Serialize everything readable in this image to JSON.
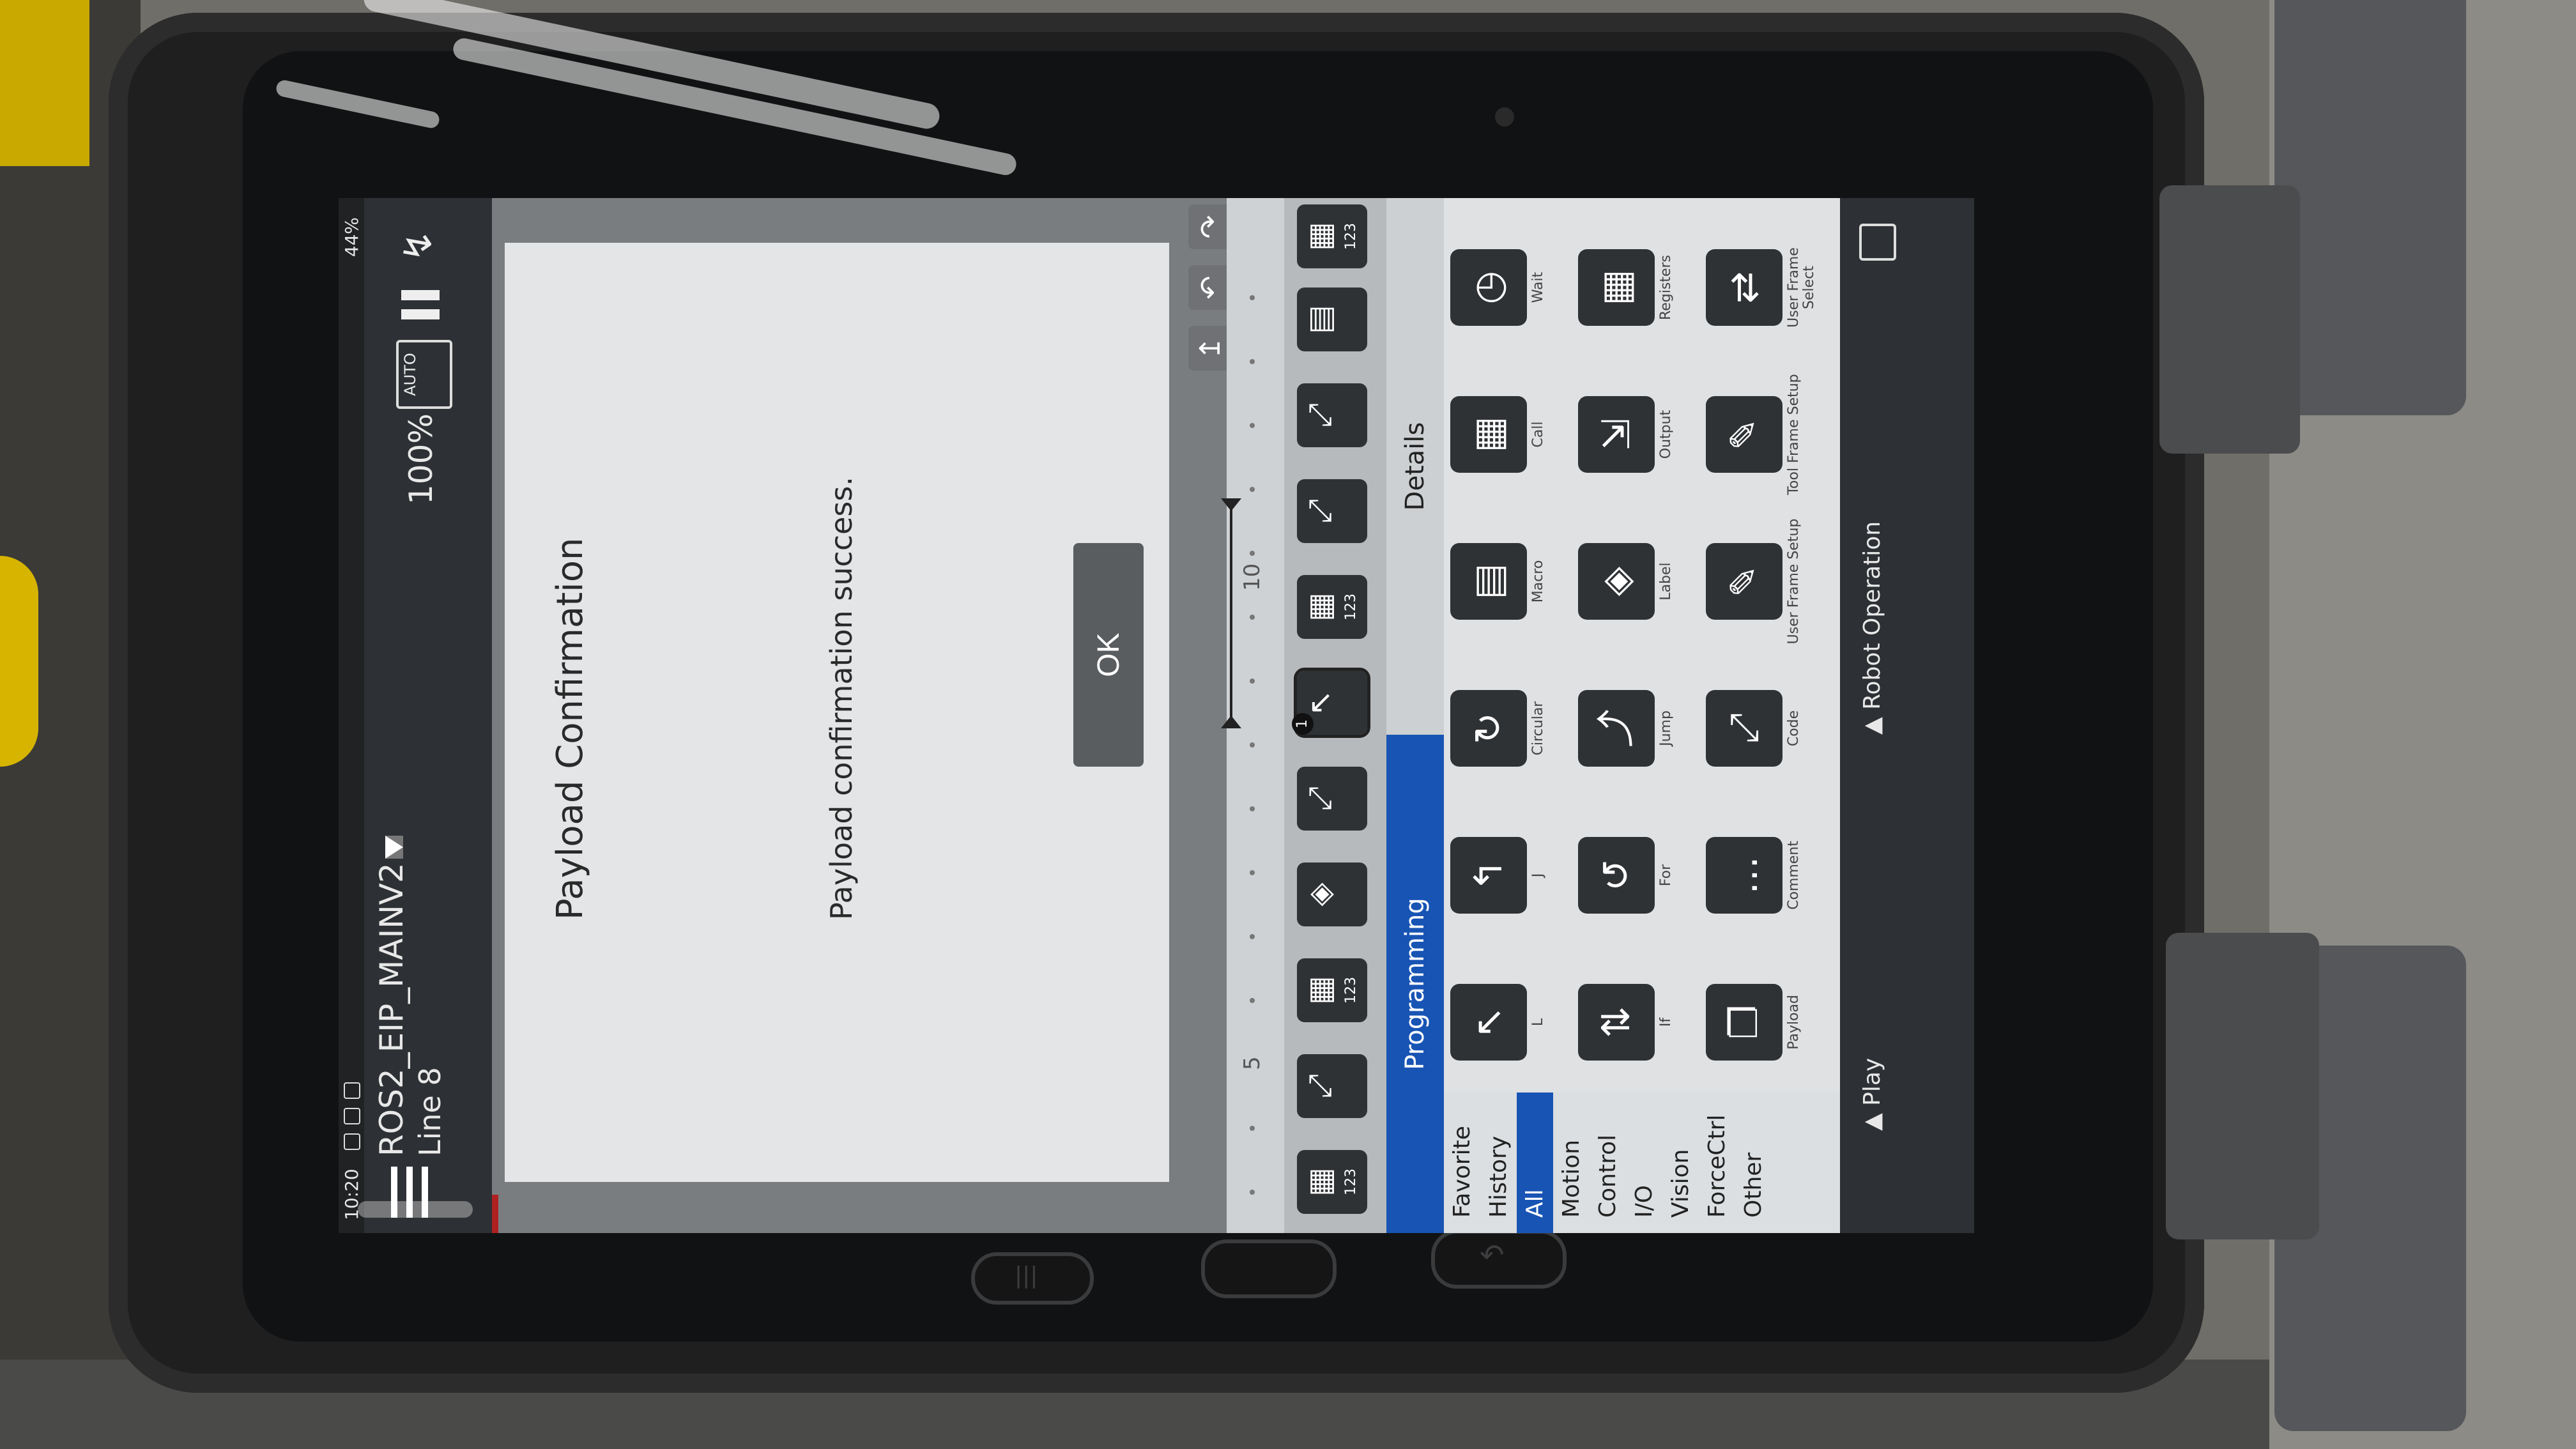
{
  "status_bar": {
    "time": "10:20",
    "battery": "44%"
  },
  "header": {
    "program_name": "ROS2_EIP_MAINV2",
    "line": "Line 8",
    "speed": "100%",
    "mode_badge": "AUTO"
  },
  "dialog": {
    "title": "Payload Confirmation",
    "message": "Payload confirmation success.",
    "ok_label": "OK"
  },
  "ruler": {
    "marks": [
      "5",
      "10"
    ]
  },
  "tabs": {
    "programming": "Programming",
    "details": "Details"
  },
  "categories": [
    "Favorite",
    "History",
    "All",
    "Motion",
    "Control",
    "I/O",
    "Vision",
    "ForceCtrl",
    "Other"
  ],
  "palette": [
    {
      "label": "L",
      "icon": "linear-move-icon"
    },
    {
      "label": "J",
      "icon": "joint-move-icon"
    },
    {
      "label": "Circular",
      "icon": "circular-move-icon"
    },
    {
      "label": "Macro",
      "icon": "macro-icon"
    },
    {
      "label": "Call",
      "icon": "call-icon"
    },
    {
      "label": "Wait",
      "icon": "wait-clock-icon"
    },
    {
      "label": "If",
      "icon": "if-icon"
    },
    {
      "label": "For",
      "icon": "for-loop-icon"
    },
    {
      "label": "Jump",
      "icon": "jump-icon"
    },
    {
      "label": "Label",
      "icon": "label-tag-icon"
    },
    {
      "label": "Output",
      "icon": "output-icon"
    },
    {
      "label": "Registers",
      "icon": "registers-icon"
    },
    {
      "label": "Payload",
      "icon": "payload-icon"
    },
    {
      "label": "Comment",
      "icon": "comment-icon"
    },
    {
      "label": "Code",
      "icon": "code-icon"
    },
    {
      "label": "User Frame Setup",
      "icon": "user-frame-setup-icon"
    },
    {
      "label": "Tool Frame Setup",
      "icon": "tool-frame-setup-icon"
    },
    {
      "label": "User Frame Select",
      "icon": "user-frame-select-icon"
    }
  ],
  "control_bar": {
    "play": "Play",
    "robot_operation": "Robot Operation"
  },
  "colors": {
    "accent": "#1854b4",
    "header": "#2d3034",
    "dialog": "#e3e5e6"
  }
}
